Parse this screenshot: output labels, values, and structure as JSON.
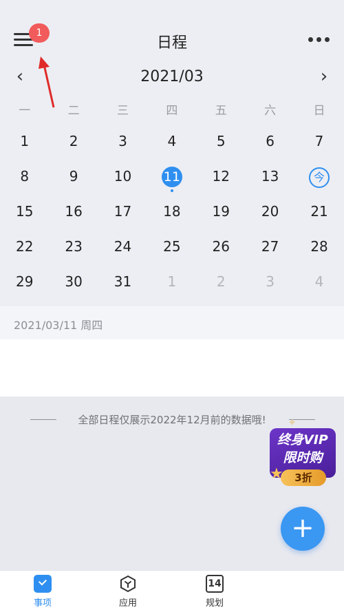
{
  "header": {
    "title": "日程",
    "badge_count": "1"
  },
  "month_nav": {
    "label": "2021/03",
    "prev_icon": "chevron-left-icon",
    "next_icon": "chevron-right-icon"
  },
  "weekdays": [
    "一",
    "二",
    "三",
    "四",
    "五",
    "六",
    "日"
  ],
  "calendar": {
    "days": [
      "1",
      "2",
      "3",
      "4",
      "5",
      "6",
      "7",
      "8",
      "9",
      "10",
      "11",
      "12",
      "13",
      "今",
      "15",
      "16",
      "17",
      "18",
      "19",
      "20",
      "21",
      "22",
      "23",
      "24",
      "25",
      "26",
      "27",
      "28",
      "29",
      "30",
      "31",
      "1",
      "2",
      "3",
      "4"
    ],
    "selected_day": "11",
    "today_marker": "今"
  },
  "date_bar": {
    "text": "2021/03/11 周四"
  },
  "notice": {
    "text": "全部日程仅展示2022年12月前的数据哦!"
  },
  "vip_badge": {
    "line1": "终身VIP",
    "line2": "限时购",
    "discount": "3折"
  },
  "fab": {
    "icon": "plus-icon",
    "label": "+"
  },
  "tabbar": {
    "items": [
      {
        "label": "事项",
        "icon": "checkbox-icon"
      },
      {
        "label": "应用",
        "icon": "apps-icon"
      },
      {
        "label": "规划",
        "icon": "calendar-14-icon",
        "icon_text": "14"
      }
    ]
  },
  "colors": {
    "accent": "#2f8ff0",
    "badge": "#f15b5b",
    "arrow": "#e02a2a"
  }
}
